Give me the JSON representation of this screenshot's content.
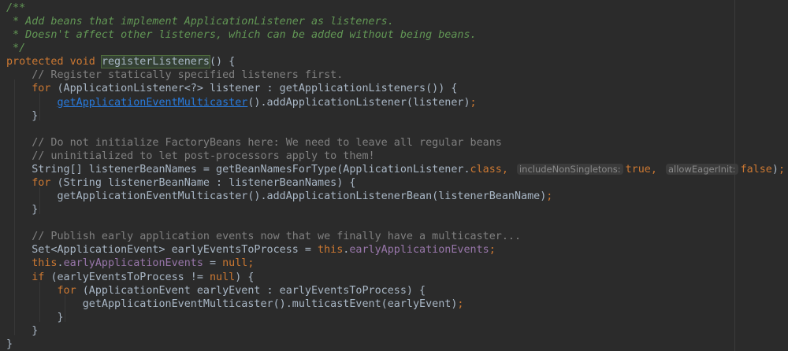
{
  "code": {
    "lines": [
      {
        "indent": 0,
        "tokens": [
          {
            "c": "doc",
            "t": "/**"
          }
        ]
      },
      {
        "indent": 0,
        "tokens": [
          {
            "c": "doc",
            "t": " * Add beans that implement ApplicationListener as listeners."
          }
        ]
      },
      {
        "indent": 0,
        "tokens": [
          {
            "c": "doc",
            "t": " * Doesn't affect other listeners, which can be added without being beans."
          }
        ]
      },
      {
        "indent": 0,
        "tokens": [
          {
            "c": "doc",
            "t": " */"
          }
        ]
      },
      {
        "indent": 0,
        "tokens": [
          {
            "c": "kw",
            "t": "protected void "
          },
          {
            "c": "decl",
            "t": "registerListeners"
          },
          {
            "c": "",
            "t": "() {"
          }
        ]
      },
      {
        "indent": 4,
        "tokens": [
          {
            "c": "cm",
            "t": "// Register statically specified listeners first."
          }
        ]
      },
      {
        "indent": 4,
        "tokens": [
          {
            "c": "kw",
            "t": "for "
          },
          {
            "c": "",
            "t": "(ApplicationListener<?> listener : getApplicationListeners()) {"
          }
        ]
      },
      {
        "indent": 8,
        "tokens": [
          {
            "c": "link",
            "t": "getApplicationEventMulticaster"
          },
          {
            "c": "",
            "t": "().addApplicationListener(listener)"
          },
          {
            "c": "kw",
            "t": ";"
          }
        ]
      },
      {
        "indent": 4,
        "tokens": [
          {
            "c": "",
            "t": "}"
          }
        ]
      },
      {
        "indent": 0,
        "tokens": []
      },
      {
        "indent": 4,
        "tokens": [
          {
            "c": "cm",
            "t": "// Do not initialize FactoryBeans here: We need to leave all regular beans"
          }
        ]
      },
      {
        "indent": 4,
        "tokens": [
          {
            "c": "cm",
            "t": "// uninitialized to let post-processors apply to them!"
          }
        ]
      },
      {
        "indent": 4,
        "tokens": [
          {
            "c": "",
            "t": "String[] listenerBeanNames = getBeanNamesForType(ApplicationListener."
          },
          {
            "c": "kw",
            "t": "class,"
          },
          {
            "c": "hint",
            "t": "includeNonSingletons:"
          },
          {
            "c": "kw",
            "t": "true,"
          },
          {
            "c": "hint",
            "t": "allowEagerInit:"
          },
          {
            "c": "kw",
            "t": "false"
          },
          {
            "c": "",
            "t": ")"
          },
          {
            "c": "kw",
            "t": ";"
          }
        ]
      },
      {
        "indent": 4,
        "tokens": [
          {
            "c": "kw",
            "t": "for "
          },
          {
            "c": "",
            "t": "(String listenerBeanName : listenerBeanNames) {"
          }
        ]
      },
      {
        "indent": 8,
        "tokens": [
          {
            "c": "",
            "t": "getApplicationEventMulticaster().addApplicationListenerBean(listenerBeanName)"
          },
          {
            "c": "kw",
            "t": ";"
          }
        ]
      },
      {
        "indent": 4,
        "tokens": [
          {
            "c": "",
            "t": "}"
          }
        ]
      },
      {
        "indent": 0,
        "tokens": []
      },
      {
        "indent": 4,
        "tokens": [
          {
            "c": "cm",
            "t": "// Publish early application events now that we finally have a multicaster..."
          }
        ]
      },
      {
        "indent": 4,
        "tokens": [
          {
            "c": "",
            "t": "Set<ApplicationEvent> earlyEventsToProcess = "
          },
          {
            "c": "kw",
            "t": "this"
          },
          {
            "c": "",
            "t": "."
          },
          {
            "c": "field",
            "t": "earlyApplicationEvents"
          },
          {
            "c": "kw",
            "t": ";"
          }
        ]
      },
      {
        "indent": 4,
        "tokens": [
          {
            "c": "kw",
            "t": "this"
          },
          {
            "c": "",
            "t": "."
          },
          {
            "c": "field",
            "t": "earlyApplicationEvents"
          },
          {
            "c": "",
            "t": " = "
          },
          {
            "c": "kw",
            "t": "null;"
          }
        ]
      },
      {
        "indent": 4,
        "tokens": [
          {
            "c": "kw",
            "t": "if "
          },
          {
            "c": "",
            "t": "(earlyEventsToProcess != "
          },
          {
            "c": "kw",
            "t": "null"
          },
          {
            "c": "",
            "t": ") {"
          }
        ]
      },
      {
        "indent": 8,
        "tokens": [
          {
            "c": "kw",
            "t": "for "
          },
          {
            "c": "",
            "t": "(ApplicationEvent earlyEvent : earlyEventsToProcess) {"
          }
        ]
      },
      {
        "indent": 12,
        "tokens": [
          {
            "c": "",
            "t": "getApplicationEventMulticaster().multicastEvent(earlyEvent)"
          },
          {
            "c": "kw",
            "t": ";"
          }
        ]
      },
      {
        "indent": 8,
        "tokens": [
          {
            "c": "",
            "t": "}"
          }
        ]
      },
      {
        "indent": 4,
        "tokens": [
          {
            "c": "",
            "t": "}"
          }
        ]
      },
      {
        "indent": 0,
        "tokens": [
          {
            "c": "",
            "t": "}"
          }
        ]
      }
    ]
  }
}
